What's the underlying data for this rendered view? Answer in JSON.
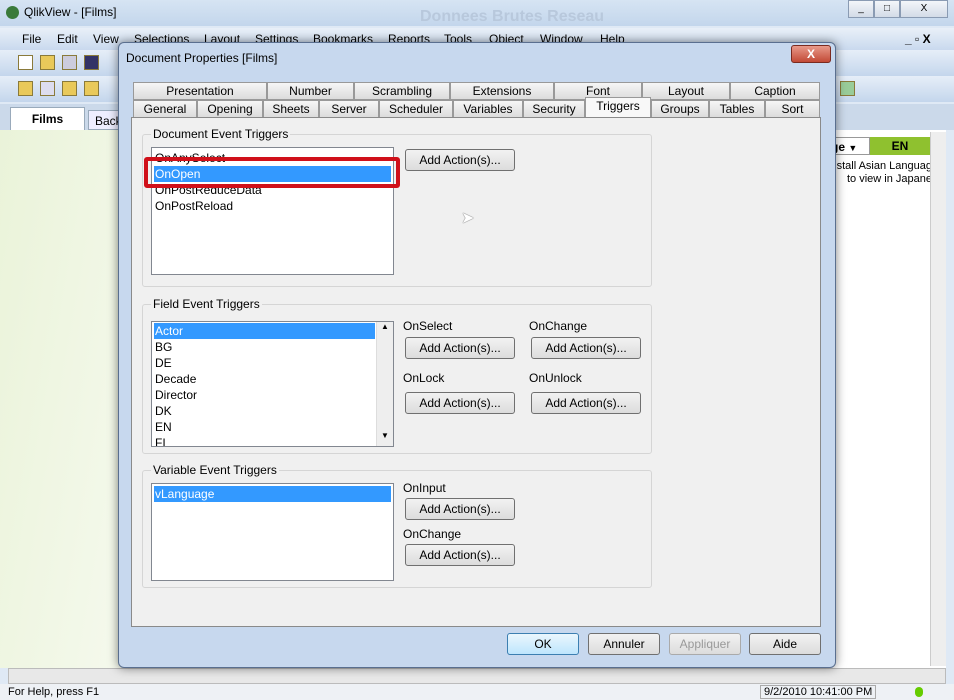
{
  "app": {
    "title": "QlikView - [Films]",
    "bg_title": "Donnees Brutes Reseau"
  },
  "menu": [
    "File",
    "Edit",
    "View",
    "Selections",
    "Layout",
    "Settings",
    "Bookmarks",
    "Reports",
    "Tools",
    "Object",
    "Window",
    "Help"
  ],
  "sheet_tabs": [
    "Films",
    "Back"
  ],
  "sheet": {
    "lang_select": "ge",
    "lang_value": "EN",
    "note_line1": "nstall Asian Languag",
    "note_line2": "to view in Japane"
  },
  "status": {
    "help": "For Help, press F1",
    "datetime": "9/2/2010 10:41:00 PM"
  },
  "dialog": {
    "title": "Document Properties [Films]",
    "close": "X",
    "tabs_row1": [
      "Presentation",
      "Number",
      "Scrambling",
      "Extensions",
      "Font",
      "Layout",
      "Caption"
    ],
    "tabs_row2": [
      "General",
      "Opening",
      "Sheets",
      "Server",
      "Scheduler",
      "Variables",
      "Security",
      "Triggers",
      "Groups",
      "Tables",
      "Sort"
    ],
    "active_tab": "Triggers",
    "doc_group": {
      "label": "Document Event Triggers",
      "items": [
        "OnAnySelect",
        "OnOpen",
        "OnPostReduceData",
        "OnPostReload"
      ],
      "selected": "OnOpen",
      "add": "Add Action(s)..."
    },
    "field_group": {
      "label": "Field Event Triggers",
      "items": [
        "Actor",
        "BG",
        "DE",
        "Decade",
        "Director",
        "DK",
        "EN",
        "FI"
      ],
      "selected": "Actor",
      "on_select": "OnSelect",
      "on_change": "OnChange",
      "on_lock": "OnLock",
      "on_unlock": "OnUnlock",
      "add": "Add Action(s)..."
    },
    "var_group": {
      "label": "Variable Event Triggers",
      "items": [
        "vLanguage"
      ],
      "selected": "vLanguage",
      "on_input": "OnInput",
      "on_change": "OnChange",
      "add": "Add Action(s)..."
    },
    "buttons": {
      "ok": "OK",
      "cancel": "Annuler",
      "apply": "Appliquer",
      "help": "Aide"
    }
  },
  "colors": {
    "selection": "#3399ff",
    "highlight_box": "#d0101a",
    "lang_green": "#8fc12f"
  }
}
